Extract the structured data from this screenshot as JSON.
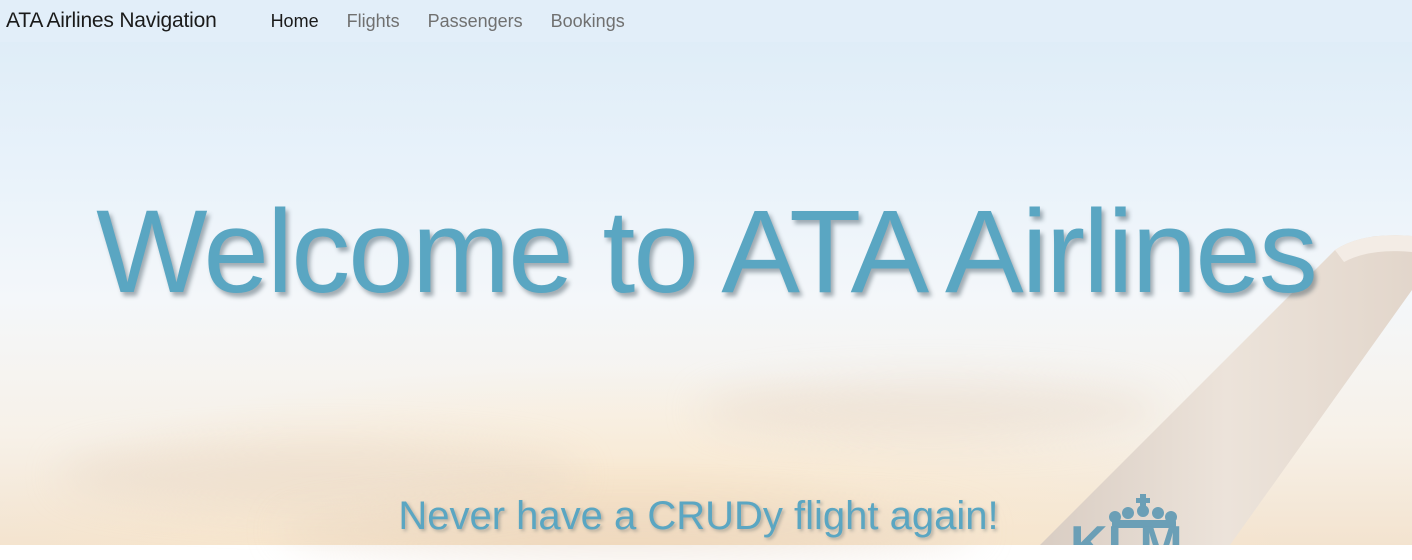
{
  "navbar": {
    "brand": "ATA Airlines Navigation",
    "items": [
      {
        "label": "Home",
        "active": true
      },
      {
        "label": "Flights",
        "active": false
      },
      {
        "label": "Passengers",
        "active": false
      },
      {
        "label": "Bookings",
        "active": false
      }
    ]
  },
  "hero": {
    "title": "Welcome to ATA Airlines",
    "subtitle": "Never have a CRUDy flight again!",
    "tail_logo": "KLM"
  },
  "colors": {
    "accent": "#5aa6c2",
    "navbar_bg": "#e2eef9",
    "nav_active": "#1a1a1a",
    "nav_inactive": "#707070"
  }
}
